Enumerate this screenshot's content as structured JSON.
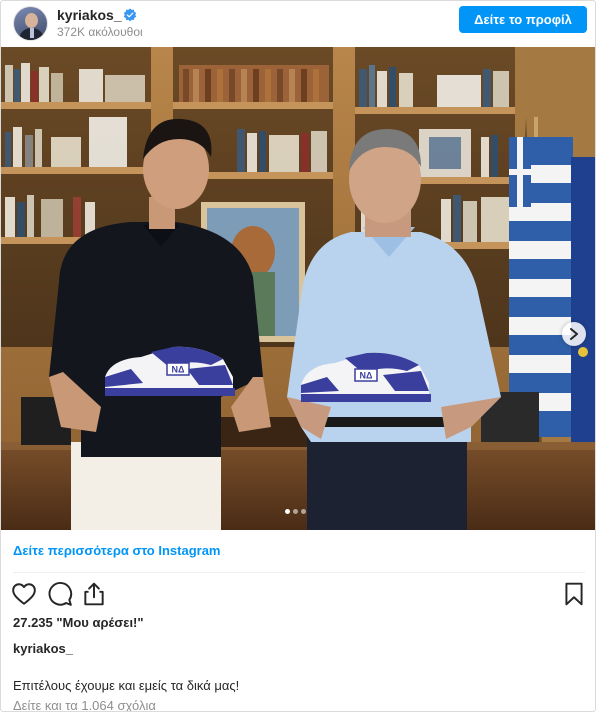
{
  "header": {
    "username": "kyriakos_",
    "followers": "372K ακόλουθοι",
    "profile_button": "Δείτε το προφίλ",
    "verified_icon": "verified-badge-icon"
  },
  "photo": {
    "slide_count": 3,
    "active_slide": 1,
    "shoe_label": "ΝΔ"
  },
  "footer": {
    "see_more": "Δείτε περισσότερα στο Instagram",
    "likes": "27.235 \"Μου αρέσει!\"",
    "caption_user": "kyriakos_",
    "caption": "Επιτέλους έχουμε και εμείς τα δικά μας!",
    "comments_link": "Δείτε και τα 1.064 σχόλια"
  },
  "icons": [
    "heart-icon",
    "comment-icon",
    "share-icon",
    "bookmark-icon",
    "chevron-right-icon"
  ],
  "colors": {
    "accent": "#0095f6",
    "text": "#262626",
    "muted": "#8e8e8e",
    "shoe_blue": "#3a3f9e"
  }
}
